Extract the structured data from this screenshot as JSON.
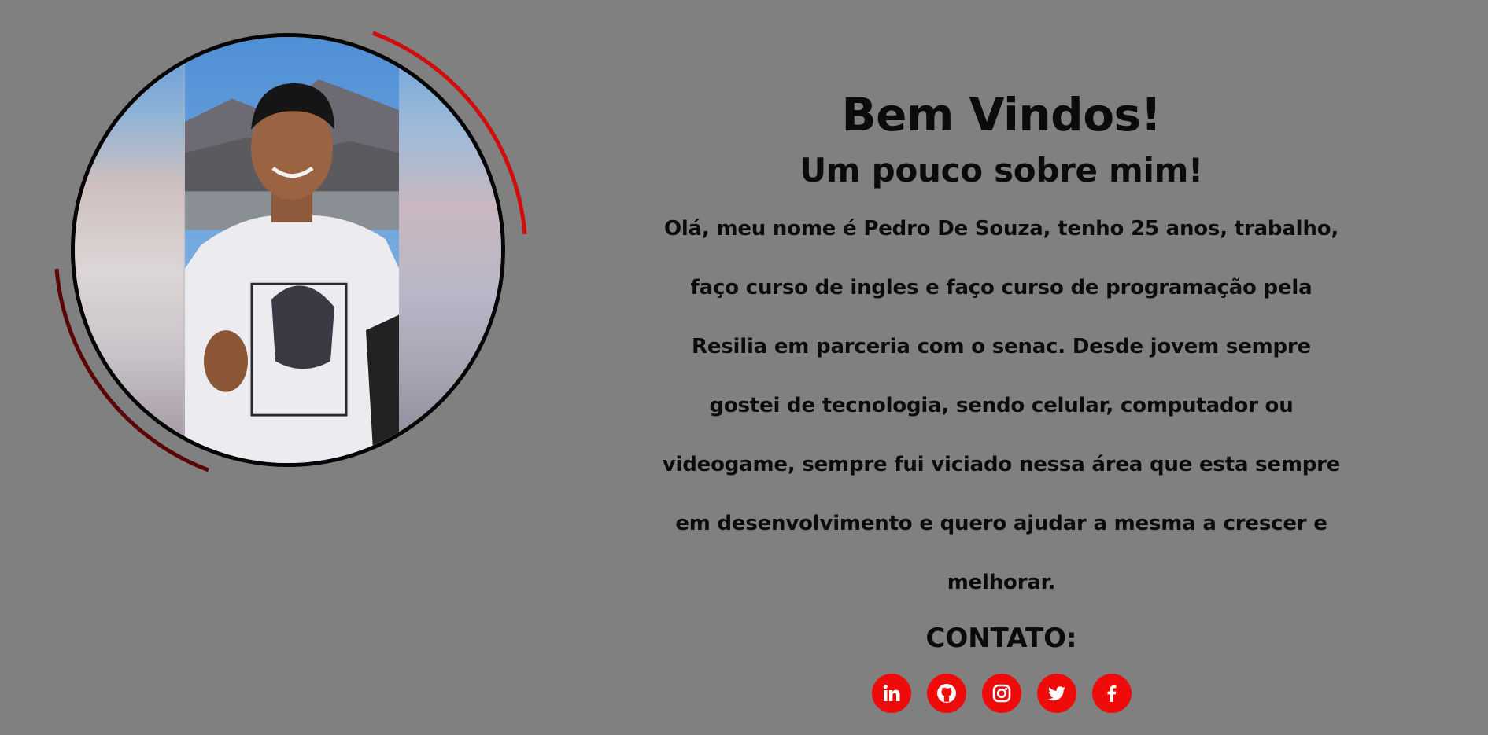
{
  "welcome": {
    "title": "Bem Vindos!",
    "subtitle": "Um pouco sobre mim!"
  },
  "about": {
    "lines": [
      "Olá, meu nome é Pedro De Souza, tenho 25 anos, trabalho,",
      "faço curso de ingles e faço curso de programação pela",
      "Resilia em parceria com o senac. Desde jovem sempre",
      "gostei de tecnologia, sendo celular, computador ou",
      "videogame, sempre fui viciado nessa área que esta sempre",
      "em desenvolvimento e quero ajudar a mesma a crescer e",
      "melhorar."
    ]
  },
  "contact": {
    "title": "CONTATO:",
    "links": [
      {
        "icon": "linkedin-icon",
        "glyph": "in"
      },
      {
        "icon": "github-icon"
      },
      {
        "icon": "instagram-icon"
      },
      {
        "icon": "twitter-icon"
      },
      {
        "icon": "facebook-icon",
        "glyph": "f"
      }
    ]
  },
  "colors": {
    "background": "#808080",
    "accent": "#f00b0b",
    "text": "#0b0b0b",
    "arc": "#cc0a0a"
  }
}
